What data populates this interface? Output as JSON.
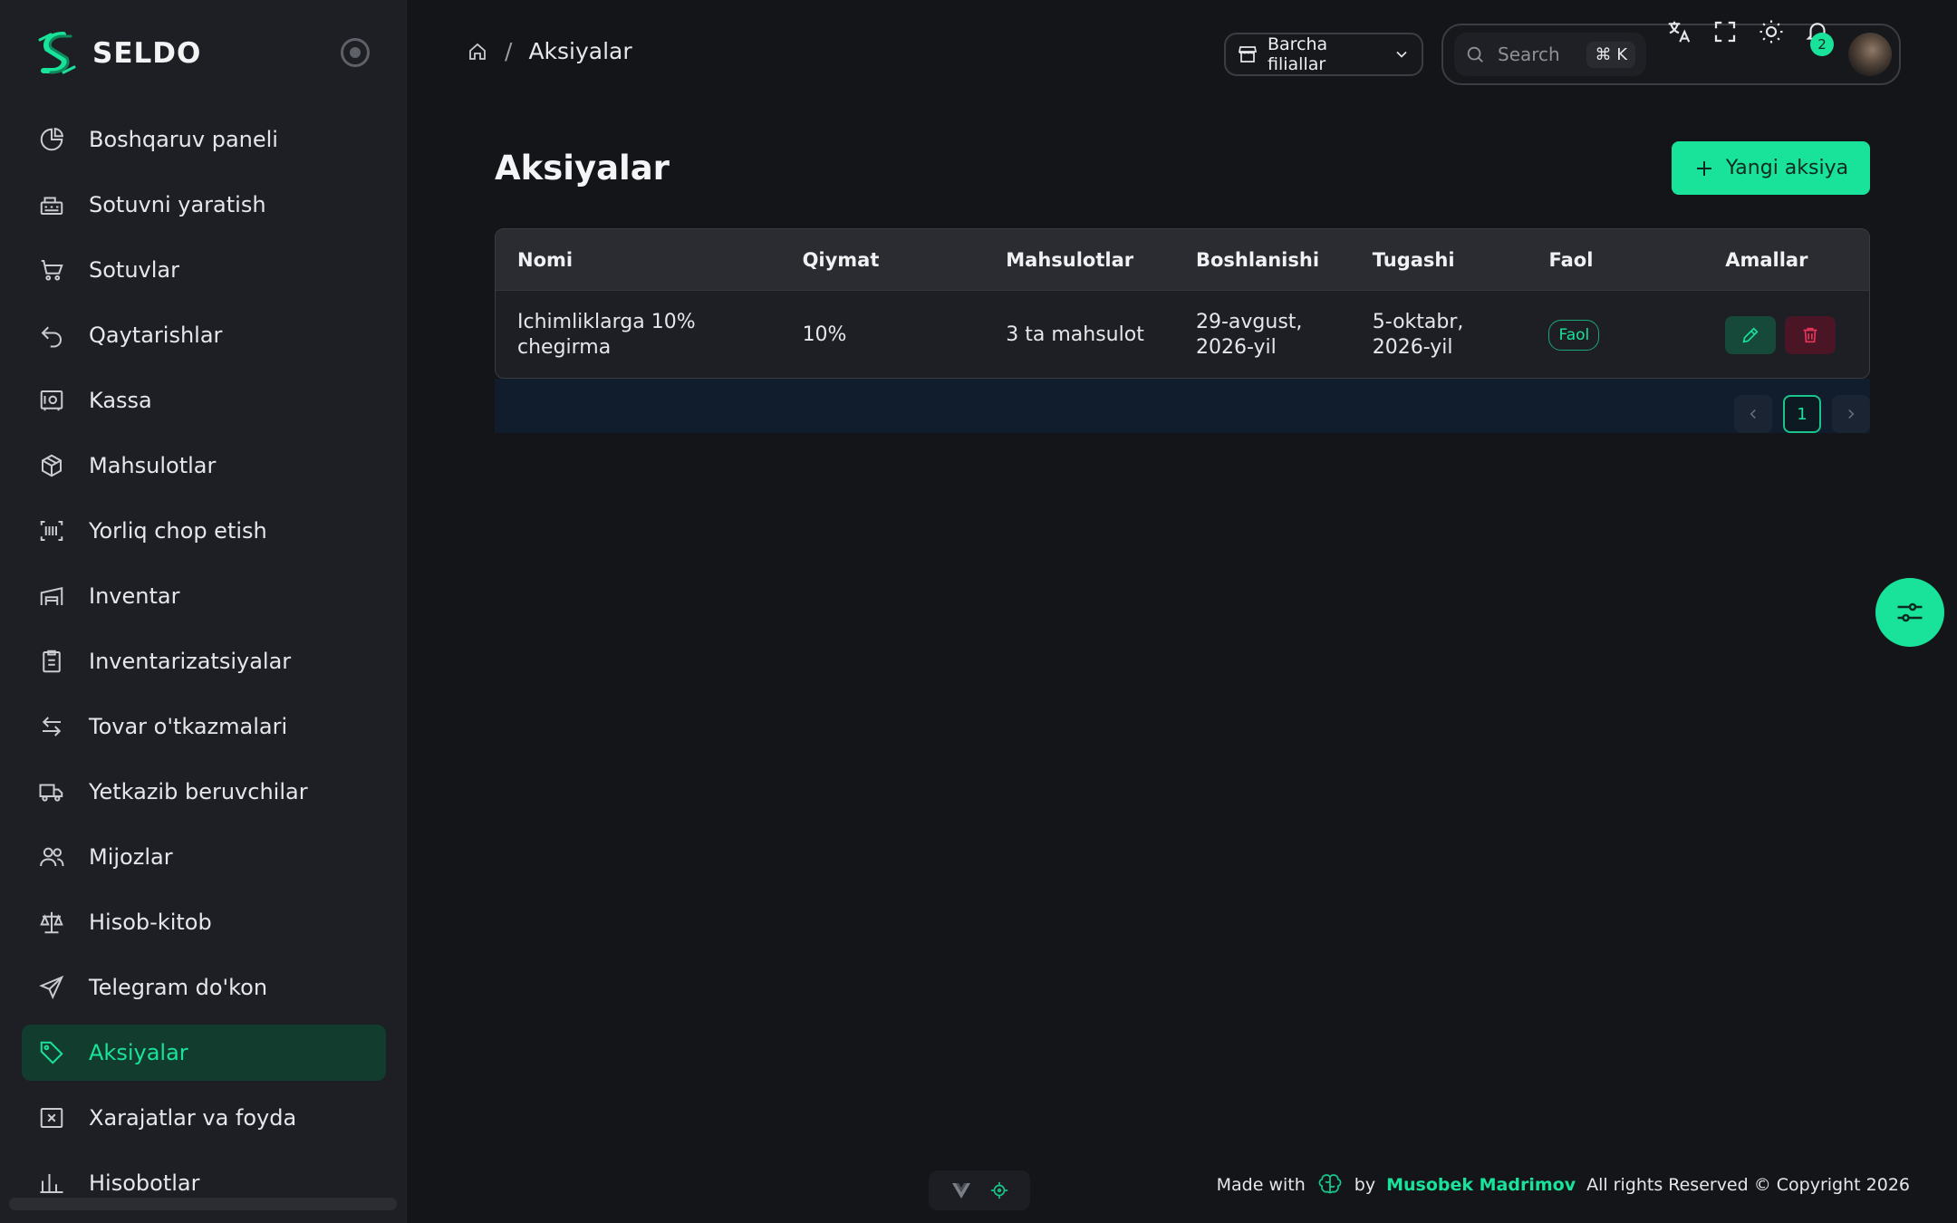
{
  "brand": {
    "name": "SELDO",
    "accent": "#19e39a"
  },
  "sidebar": {
    "items": [
      {
        "label": "Boshqaruv paneli",
        "icon": "pie-chart-icon"
      },
      {
        "label": "Sotuvni yaratish",
        "icon": "cash-register-icon"
      },
      {
        "label": "Sotuvlar",
        "icon": "cart-icon"
      },
      {
        "label": "Qaytarishlar",
        "icon": "return-arrow-icon"
      },
      {
        "label": "Kassa",
        "icon": "safe-icon"
      },
      {
        "label": "Mahsulotlar",
        "icon": "box-icon"
      },
      {
        "label": "Yorliq chop etish",
        "icon": "barcode-icon"
      },
      {
        "label": "Inventar",
        "icon": "warehouse-icon"
      },
      {
        "label": "Inventarizatsiyalar",
        "icon": "clipboard-icon"
      },
      {
        "label": "Tovar o'tkazmalari",
        "icon": "transfer-icon"
      },
      {
        "label": "Yetkazib beruvchilar",
        "icon": "truck-icon"
      },
      {
        "label": "Mijozlar",
        "icon": "users-icon"
      },
      {
        "label": "Hisob-kitob",
        "icon": "scale-icon"
      },
      {
        "label": "Telegram do'kon",
        "icon": "send-icon"
      },
      {
        "label": "Aksiyalar",
        "icon": "tag-icon",
        "active": true
      },
      {
        "label": "Xarajatlar va foyda",
        "icon": "receipt-x-icon"
      },
      {
        "label": "Hisobotlar",
        "icon": "chart-icon"
      }
    ]
  },
  "header": {
    "breadcrumb": {
      "current": "Aksiyalar"
    },
    "branch_select": "Barcha filiallar",
    "search": {
      "placeholder": "Search",
      "shortcut": "⌘ K"
    },
    "notifications_count": "2"
  },
  "main": {
    "title": "Aksiyalar",
    "new_button": "Yangi aksiya",
    "table": {
      "columns": [
        "Nomi",
        "Qiymat",
        "Mahsulotlar",
        "Boshlanishi",
        "Tugashi",
        "Faol",
        "Amallar"
      ],
      "rows": [
        {
          "name": "Ichimliklarga 10% chegirma",
          "value": "10%",
          "products": "3 ta mahsulot",
          "start": "29-avgust, 2026-yil",
          "end": "5-oktabr, 2026-yil",
          "active": "Faol"
        }
      ]
    },
    "pagination": {
      "current_page": "1"
    }
  },
  "footer": {
    "made_with": "Made with",
    "by": "by",
    "author": "Musobek Madrimov",
    "rights": "All rights Reserved © Copyright 2026"
  }
}
